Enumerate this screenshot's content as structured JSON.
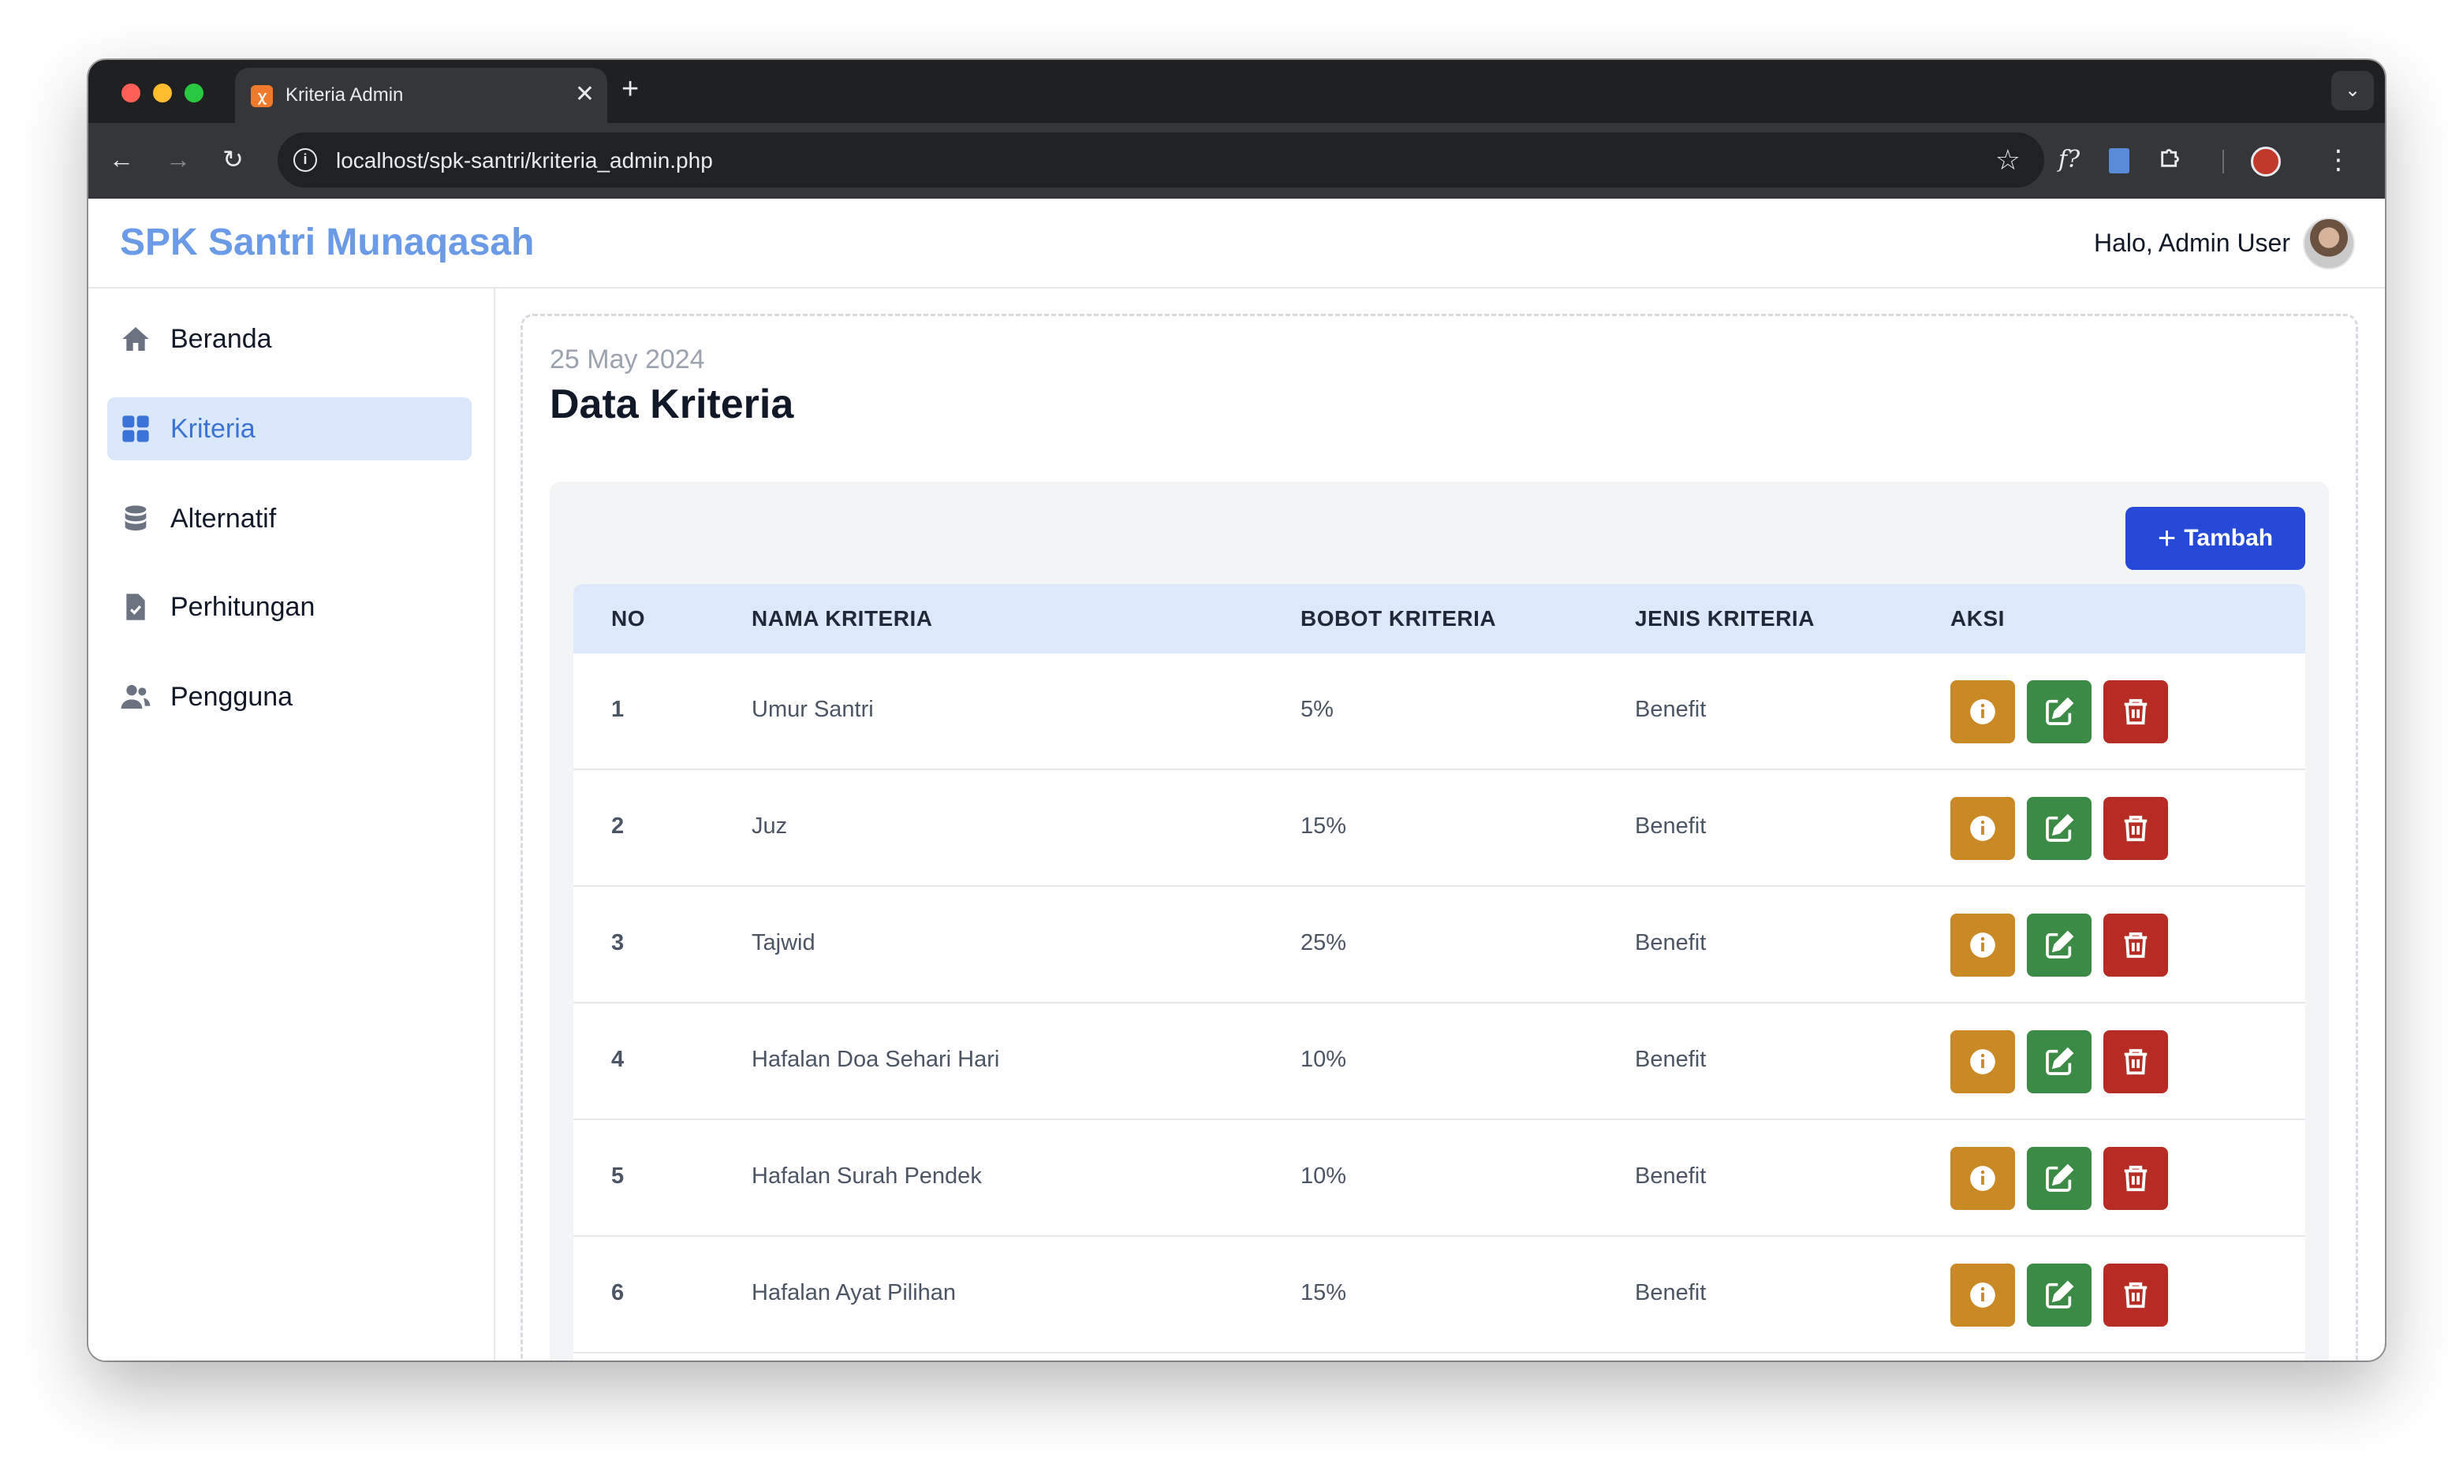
{
  "browser": {
    "tab_title": "Kriteria Admin",
    "url": "localhost/spk-santri/kriteria_admin.php"
  },
  "header": {
    "brand": "SPK Santri Munaqasah",
    "greeting": "Halo, Admin User"
  },
  "sidebar": {
    "items": [
      {
        "label": "Beranda",
        "icon": "home-icon"
      },
      {
        "label": "Kriteria",
        "icon": "grid-icon",
        "active": true
      },
      {
        "label": "Alternatif",
        "icon": "database-icon"
      },
      {
        "label": "Perhitungan",
        "icon": "document-check-icon"
      },
      {
        "label": "Pengguna",
        "icon": "users-icon"
      }
    ]
  },
  "main": {
    "date": "25 May 2024",
    "title": "Data Kriteria",
    "add_button": "Tambah",
    "table": {
      "headers": [
        "NO",
        "NAMA KRITERIA",
        "BOBOT KRITERIA",
        "JENIS KRITERIA",
        "AKSI"
      ],
      "rows": [
        {
          "no": "1",
          "nama": "Umur Santri",
          "bobot": "5%",
          "jenis": "Benefit"
        },
        {
          "no": "2",
          "nama": "Juz",
          "bobot": "15%",
          "jenis": "Benefit"
        },
        {
          "no": "3",
          "nama": "Tajwid",
          "bobot": "25%",
          "jenis": "Benefit"
        },
        {
          "no": "4",
          "nama": "Hafalan Doa Sehari Hari",
          "bobot": "10%",
          "jenis": "Benefit"
        },
        {
          "no": "5",
          "nama": "Hafalan Surah Pendek",
          "bobot": "10%",
          "jenis": "Benefit"
        },
        {
          "no": "6",
          "nama": "Hafalan Ayat Pilihan",
          "bobot": "15%",
          "jenis": "Benefit"
        }
      ]
    }
  },
  "colors": {
    "brand": "#6b9ae6",
    "primary": "#2649d8",
    "info": "#c98a26",
    "edit": "#3b8a46",
    "delete": "#b62c24",
    "table_header_bg": "#dde9fb",
    "active_nav_bg": "#dbe7fb"
  }
}
